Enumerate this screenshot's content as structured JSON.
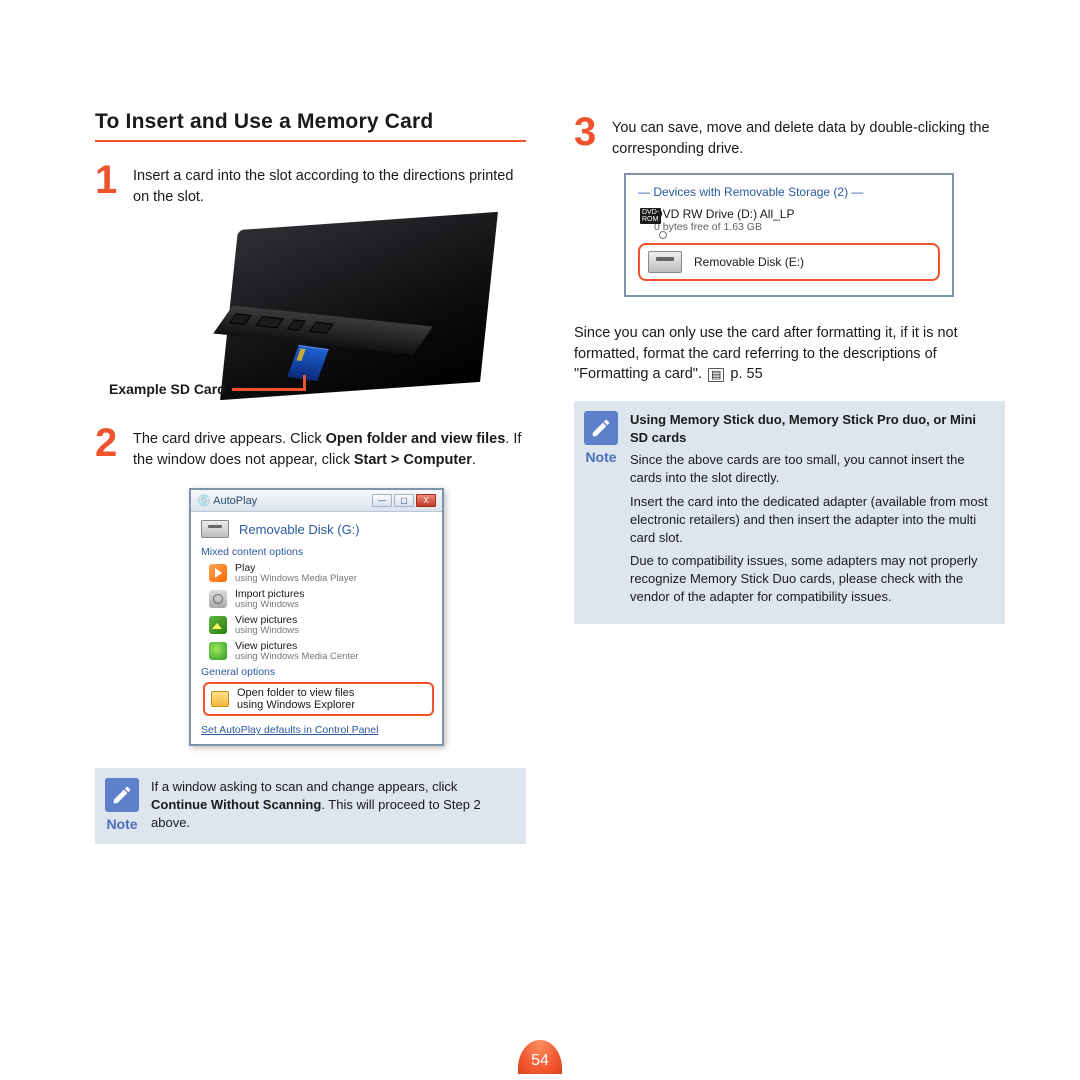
{
  "page_number": "54",
  "title": "To Insert and Use a Memory Card",
  "steps": {
    "s1": {
      "num": "1",
      "text": "Insert a card into the slot according to the directions printed on the slot."
    },
    "s2": {
      "num": "2",
      "pre": "The card drive appears. Click ",
      "b1": "Open folder and view files",
      "mid": ". If the window does not appear, click ",
      "b2": "Start > Computer",
      "post": "."
    },
    "s3": {
      "num": "3",
      "text": "You can save, move and delete data by double-clicking the corresponding drive."
    }
  },
  "sd_label": "Example SD Card",
  "autoplay": {
    "title": "AutoPlay",
    "drive": "Removable Disk (G:)",
    "group1": "Mixed content options",
    "items": [
      {
        "t1": "Play",
        "t2": "using Windows Media Player"
      },
      {
        "t1": "Import pictures",
        "t2": "using Windows"
      },
      {
        "t1": "View pictures",
        "t2": "using Windows"
      },
      {
        "t1": "View pictures",
        "t2": "using Windows Media Center"
      }
    ],
    "group2": "General options",
    "hl": {
      "t1": "Open folder to view files",
      "t2": "using Windows Explorer"
    },
    "footer": "Set AutoPlay defaults in Control Panel"
  },
  "note1": {
    "label": "Note",
    "pre": "If a window asking to scan and change appears, click ",
    "b": "Continue Without Scanning",
    "post": ". This will proceed to Step 2 above."
  },
  "devices": {
    "group": "Devices with Removable Storage (2)",
    "dvd_l1": "DVD RW Drive (D:) All_LP",
    "dvd_l2": "0 bytes free of 1.63 GB",
    "dvd_badge": "DVD-ROM",
    "rem": "Removable Disk (E:)"
  },
  "format_para": {
    "pre": "Since you can only use the card after formatting it, if it is not formatted, format the card referring to the descriptions of \"Formatting a card\". ",
    "pref": "p. 55"
  },
  "note2": {
    "label": "Note",
    "heading": "Using Memory Stick duo, Memory Stick Pro duo, or Mini SD cards",
    "p1": "Since the above cards are too small, you cannot insert the cards into the slot directly.",
    "p2": "Insert the card into the dedicated adapter (available from most electronic retailers) and then insert the adapter into the multi card slot.",
    "p3": "Due to compatibility issues, some adapters may not properly recognize Memory Stick Duo cards, please check with the vendor of the adapter for compatibility issues."
  }
}
